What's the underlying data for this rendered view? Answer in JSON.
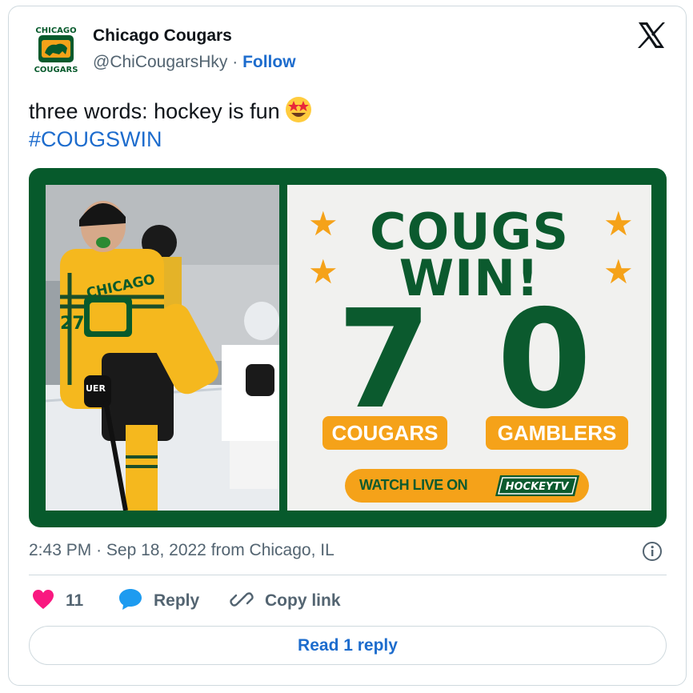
{
  "author": {
    "name": "Chicago Cougars",
    "handle": "@ChiCougarsHky",
    "separator": "·",
    "follow_label": "Follow",
    "avatar": {
      "top_text": "CHICAGO",
      "bottom_text": "COUGARS"
    }
  },
  "tweet": {
    "text": "three words: hockey is fun",
    "emoji": "star-struck-emoji",
    "hashtag": "#COUGSWIN"
  },
  "media": {
    "headline_line1": "COUGS",
    "headline_line2": "WIN!",
    "home_score": "7",
    "away_score": "0",
    "home_team": "COUGARS",
    "away_team": "GAMBLERS",
    "watch_label": "WATCH LIVE ON",
    "watch_brand": "HOCKEYTV",
    "photo": {
      "jersey_text": "CHICAGO",
      "number": "27",
      "stick_brand": "UER"
    }
  },
  "meta": {
    "time": "2:43 PM",
    "separator": "·",
    "date": "Sep 18, 2022",
    "location": "from Chicago, IL"
  },
  "actions": {
    "like_count": "11",
    "reply_label": "Reply",
    "copy_label": "Copy link",
    "read_replies_label": "Read 1 reply"
  },
  "colors": {
    "brand_green": "#075a2c",
    "brand_gold": "#f5a219",
    "link_blue": "#1d6ccd",
    "like_pink": "#f91880",
    "reply_blue": "#1d9bf0",
    "muted_text": "#536471"
  },
  "icons": [
    "x-logo-icon",
    "info-icon",
    "heart-icon",
    "reply-bubble-icon",
    "link-icon",
    "star-icon"
  ]
}
